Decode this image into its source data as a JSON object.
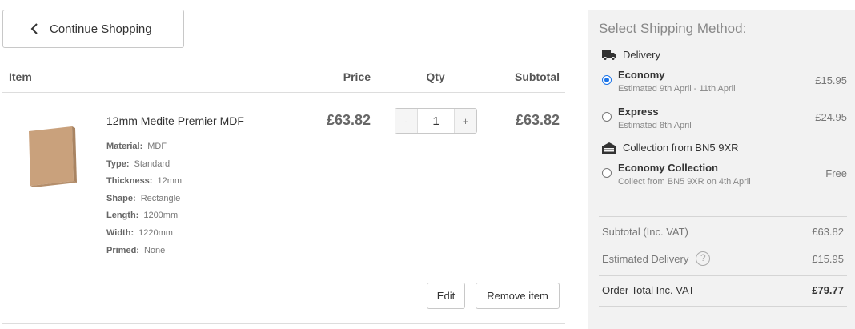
{
  "nav": {
    "continue_label": "Continue Shopping"
  },
  "cart": {
    "headers": {
      "item": "Item",
      "price": "Price",
      "qty": "Qty",
      "subtotal": "Subtotal"
    },
    "item": {
      "name": "12mm Medite Premier MDF",
      "attributes": [
        {
          "key": "Material:",
          "value": "MDF"
        },
        {
          "key": "Type:",
          "value": "Standard"
        },
        {
          "key": "Thickness:",
          "value": "12mm"
        },
        {
          "key": "Shape:",
          "value": "Rectangle"
        },
        {
          "key": "Length:",
          "value": "1200mm"
        },
        {
          "key": "Width:",
          "value": "1220mm"
        },
        {
          "key": "Primed:",
          "value": "None"
        }
      ],
      "price": "£63.82",
      "quantity": "1",
      "qty_minus": "-",
      "qty_plus": "+",
      "subtotal": "£63.82"
    },
    "edit_label": "Edit",
    "remove_label": "Remove item"
  },
  "shipping": {
    "title": "Select Shipping Method:",
    "delivery_group": "Delivery",
    "collection_group": "Collection from BN5 9XR",
    "options": [
      {
        "name": "Economy",
        "date": "Estimated 9th April - 11th April",
        "price": "£15.95",
        "selected": true
      },
      {
        "name": "Express",
        "date": "Estimated 8th April",
        "price": "£24.95",
        "selected": false
      },
      {
        "name": "Economy Collection",
        "date": "Collect from BN5 9XR on 4th April",
        "price": "Free",
        "selected": false
      }
    ]
  },
  "summary": {
    "subtotal_label": "Subtotal (Inc. VAT)",
    "subtotal_value": "£63.82",
    "delivery_label": "Estimated Delivery",
    "delivery_help": "?",
    "delivery_value": "£15.95",
    "total_label": "Order Total Inc. VAT",
    "total_value": "£79.77"
  },
  "colors": {
    "accent": "#1a73e8",
    "panel_bg": "#f2f2f2",
    "border": "#c8c8c8"
  },
  "icons": [
    "chevron-left-icon",
    "truck-icon",
    "warehouse-icon",
    "help-icon"
  ]
}
